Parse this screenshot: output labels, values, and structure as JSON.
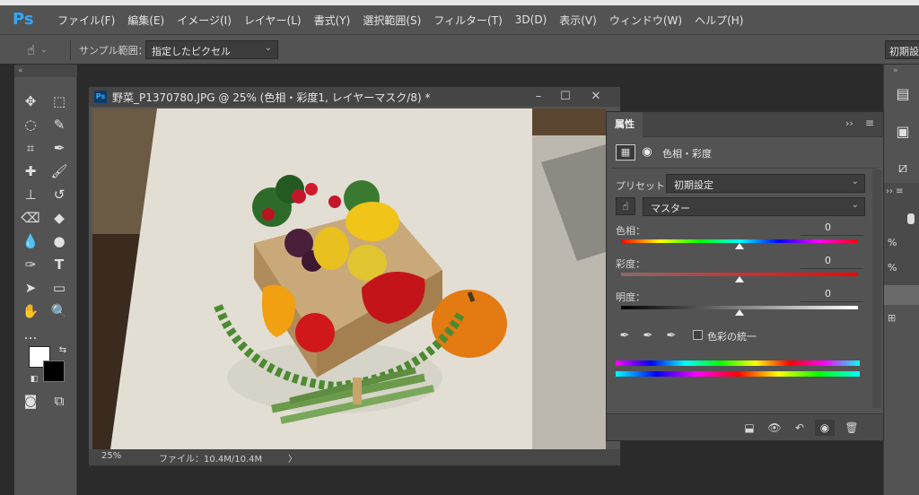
{
  "app": {
    "logo": "Ps",
    "menu": [
      "ファイル(F)",
      "編集(E)",
      "イメージ(I)",
      "レイヤー(L)",
      "書式(Y)",
      "選択範囲(S)",
      "フィルター(T)",
      "3D(D)",
      "表示(V)",
      "ウィンドウ(W)",
      "ヘルプ(H)"
    ]
  },
  "options_bar": {
    "tool_icon": "hand-pointer-icon",
    "sample_label": "サンプル範囲：",
    "sample_value": "指定したピクセル",
    "right_button": "初期設"
  },
  "document": {
    "title": "野菜_P1370780.JPG @ 25% (色相・彩度1, レイヤーマスク/8) *",
    "zoom": "25%",
    "file_info": "ファイル：10.4M/10.4M",
    "status_arrow": "〉"
  },
  "properties": {
    "tab": "属性",
    "expand": "››",
    "adjustment_title": "色相・彩度",
    "preset_label": "プリセット：",
    "preset_value": "初期設定",
    "channel_value": "マスター",
    "hue_label": "色相：",
    "hue_value": "0",
    "saturation_label": "彩度：",
    "saturation_value": "0",
    "lightness_label": "明度：",
    "lightness_value": "0",
    "colorize_label": "色彩の統一"
  },
  "colors": {
    "accent": "#31a8ff",
    "panel": "#535353",
    "dark": "#2b2b2b"
  }
}
